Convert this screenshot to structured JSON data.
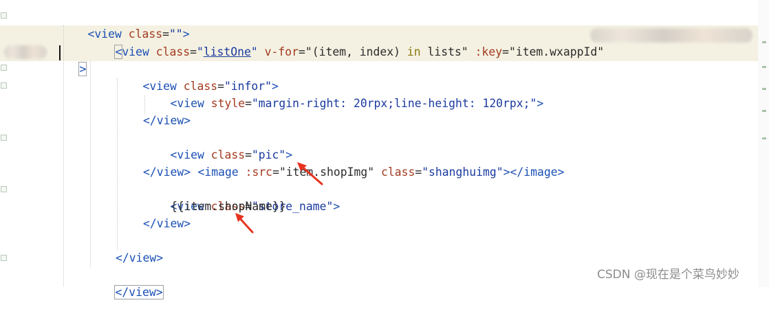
{
  "code": {
    "l1": {
      "open": "<",
      "tag": "view",
      "sp": " ",
      "attr": "class",
      "eq": "=",
      "val": "\"\"",
      "close": ">"
    },
    "l2": {
      "open": "<",
      "tag": "view",
      "sp": " ",
      "a1": "class",
      "eq1": "=",
      "q1": "\"",
      "v1": "listOne",
      "q1e": "\"",
      "sp2": " ",
      "a2": "v-for",
      "eq2": "=",
      "v2a": "\"(item, index) ",
      "kw": "in",
      "v2b": " lists\"",
      "sp3": " ",
      "a3": ":key",
      "eq3": "=",
      "v3": "\"item.wxappId\""
    },
    "l3": {
      "close": ">"
    },
    "l4": {
      "open": "<",
      "tag": "view",
      "sp": " ",
      "attr": "class",
      "eq": "=",
      "val": "\"infor\"",
      "close": ">"
    },
    "l5": {
      "open": "<",
      "tag": "view",
      "sp": " ",
      "attr": "style",
      "eq": "=",
      "val": "\"margin-right: 20rpx;line-height: 120rpx;\"",
      "close": ">"
    },
    "l7": {
      "text": "</view>"
    },
    "l8": {
      "open": "<",
      "tag": "view",
      "sp": " ",
      "attr": "class",
      "eq": "=",
      "val": "\"pic\"",
      "close": ">"
    },
    "l9": {
      "open": "<",
      "tag": "image",
      "sp": " ",
      "a1": ":src",
      "eq1": "=",
      "v1": "\"item.shopImg\"",
      "sp2": " ",
      "a2": "class",
      "eq2": "=",
      "v2": "\"shanghuimg\"",
      "close": "></image>"
    },
    "l10": {
      "text": "</view>"
    },
    "l11": {
      "open": "<",
      "tag": "view",
      "sp": " ",
      "attr": "class",
      "eq": "=",
      "val": "\"store_name\"",
      "close": ">"
    },
    "l12": {
      "text": "{{item.shopName}}"
    },
    "l13": {
      "text": "</view>"
    },
    "l15": {
      "text": "</view>"
    },
    "l16": {
      "text": "</view>"
    }
  },
  "watermark": "CSDN @现在是个菜鸟妙妙",
  "colors": {
    "tag": "#1a4fb5",
    "attribute": "#a33a1f",
    "string": "#1a3aa0",
    "keyword": "#8a7a0e",
    "arrow": "#e8321e",
    "current_line": "#f4f1e2"
  },
  "icons": {
    "annotation_arrow": "red-arrow-icon",
    "fold_marker": "fold-marker-icon"
  }
}
